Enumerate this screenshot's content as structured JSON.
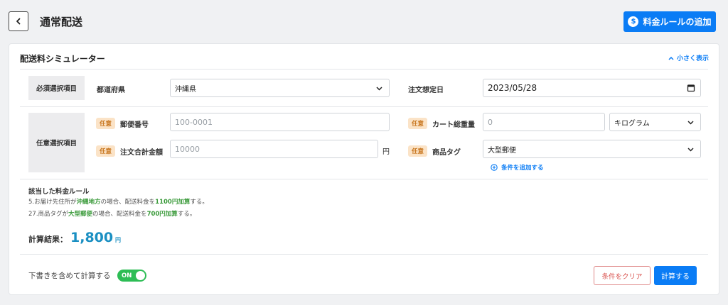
{
  "header": {
    "title": "通常配送",
    "add_rule_label": "料金ルールの追加",
    "add_rule_icon": "dollar-circle-icon"
  },
  "simulator": {
    "title": "配送料シミュレーター",
    "collapse_label": "小さく表示",
    "required_group": {
      "label": "必須選択項目",
      "prefecture_label": "都道府県",
      "prefecture_value": "沖縄県",
      "order_date_label": "注文想定日",
      "order_date_value": "2023/05/28"
    },
    "optional_group": {
      "label": "任意選択項目",
      "badge": "任意",
      "postal_label": "郵便番号",
      "postal_placeholder": "100-0001",
      "cart_weight_label": "カート総重量",
      "cart_weight_placeholder": "0",
      "weight_unit_value": "キログラム",
      "order_total_label": "注文合計金額",
      "order_total_placeholder": "10000",
      "order_total_unit": "円",
      "product_tag_label": "商品タグ",
      "product_tag_value": "大型郵便",
      "add_condition_label": "条件を追加する"
    },
    "rules": {
      "title": "該当した料金ルール",
      "line1": {
        "a": "5.お届け先住所が",
        "b": "沖縄地方",
        "c": "の場合、配送料金を",
        "d": "1100円加算",
        "e": "する。"
      },
      "line2": {
        "a": "27.商品タグが",
        "b": "大型郵便",
        "c": "の場合、配送料金を",
        "d": "700円加算",
        "e": "する。"
      }
    },
    "result": {
      "label": "計算結果：",
      "value": "1,800",
      "unit": "円"
    },
    "footer": {
      "draft_label": "下書きを含めて計算する",
      "toggle_label": "ON",
      "clear_label": "条件をクリア",
      "calc_label": "計算する"
    }
  },
  "colors": {
    "accent": "#0a7cf5",
    "toggle_on": "#2dbd55",
    "highlight": "#3a9a3a",
    "result": "#1a8fc2"
  }
}
